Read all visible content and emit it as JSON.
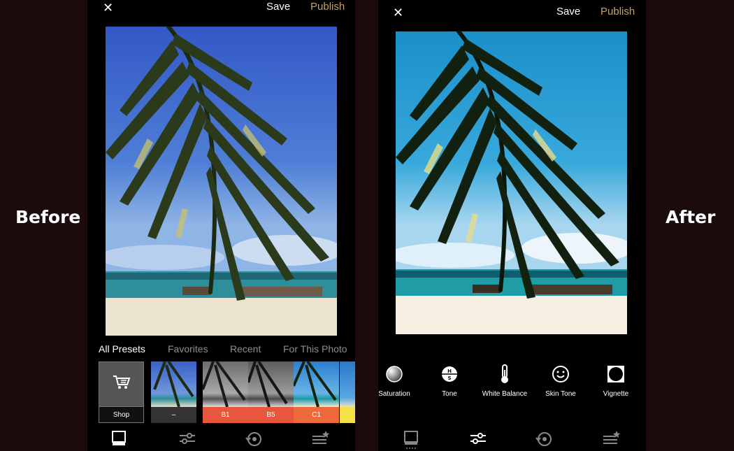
{
  "labels": {
    "before": "Before",
    "after": "After"
  },
  "left_phone": {
    "close_icon": "close-x",
    "save_label": "Save",
    "publish_label": "Publish",
    "preset_tabs": [
      "All Presets",
      "Favorites",
      "Recent",
      "For This Photo"
    ],
    "presets": [
      {
        "label": "Shop",
        "icon": "shopping-cart-icon"
      },
      {
        "label": "–"
      },
      {
        "label": "B1"
      },
      {
        "label": "B5"
      },
      {
        "label": "C1"
      }
    ],
    "nav_icons": [
      "presets-icon",
      "adjust-sliders-icon",
      "history-icon",
      "recipes-icon"
    ]
  },
  "right_phone": {
    "close_icon": "close-x",
    "save_label": "Save",
    "publish_label": "Publish",
    "tools": [
      {
        "label": "Saturation",
        "icon": "saturation-icon"
      },
      {
        "label": "Tone",
        "icon": "tone-icon"
      },
      {
        "label": "White Balance",
        "icon": "thermometer-icon"
      },
      {
        "label": "Skin Tone",
        "icon": "smiley-icon"
      },
      {
        "label": "Vignette",
        "icon": "vignette-icon"
      }
    ],
    "nav_icons": [
      "presets-icon",
      "adjust-sliders-icon",
      "history-icon",
      "recipes-icon"
    ]
  },
  "colors": {
    "background": "#1c0b0d",
    "publish": "#c5a367",
    "preset_caption_red": "#e8573d",
    "preset_caption_orange": "#ee6a3a",
    "preset_yellow": "#f5e046"
  }
}
